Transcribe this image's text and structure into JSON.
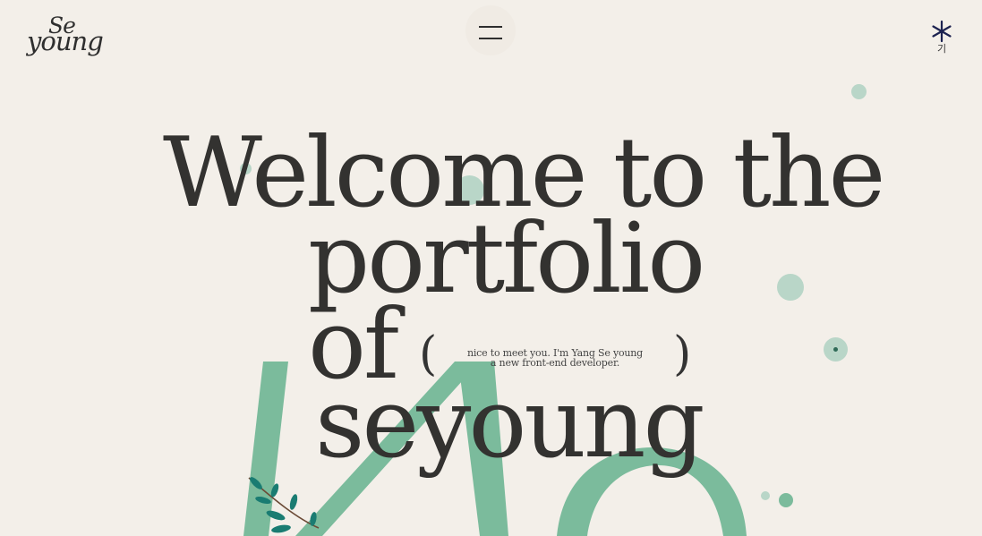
{
  "logo": {
    "line1": "Se",
    "line2": "young"
  },
  "menu": {
    "aria": "menu"
  },
  "corner": {
    "label": "기"
  },
  "headline": {
    "line1": "Welcome to the",
    "line2": "portfolio",
    "line3": "of",
    "line4": "seyoung"
  },
  "intro": {
    "line1": "nice to meet you. I'm Yang Se young",
    "line2": "a new front-end developer."
  },
  "colors": {
    "background": "#f3efe9",
    "accent_green": "#7bbb9c",
    "soft_green": "#b9d6c8",
    "leaf_teal": "#1a7c72",
    "text": "#333230",
    "asterisk": "#1c2250"
  }
}
